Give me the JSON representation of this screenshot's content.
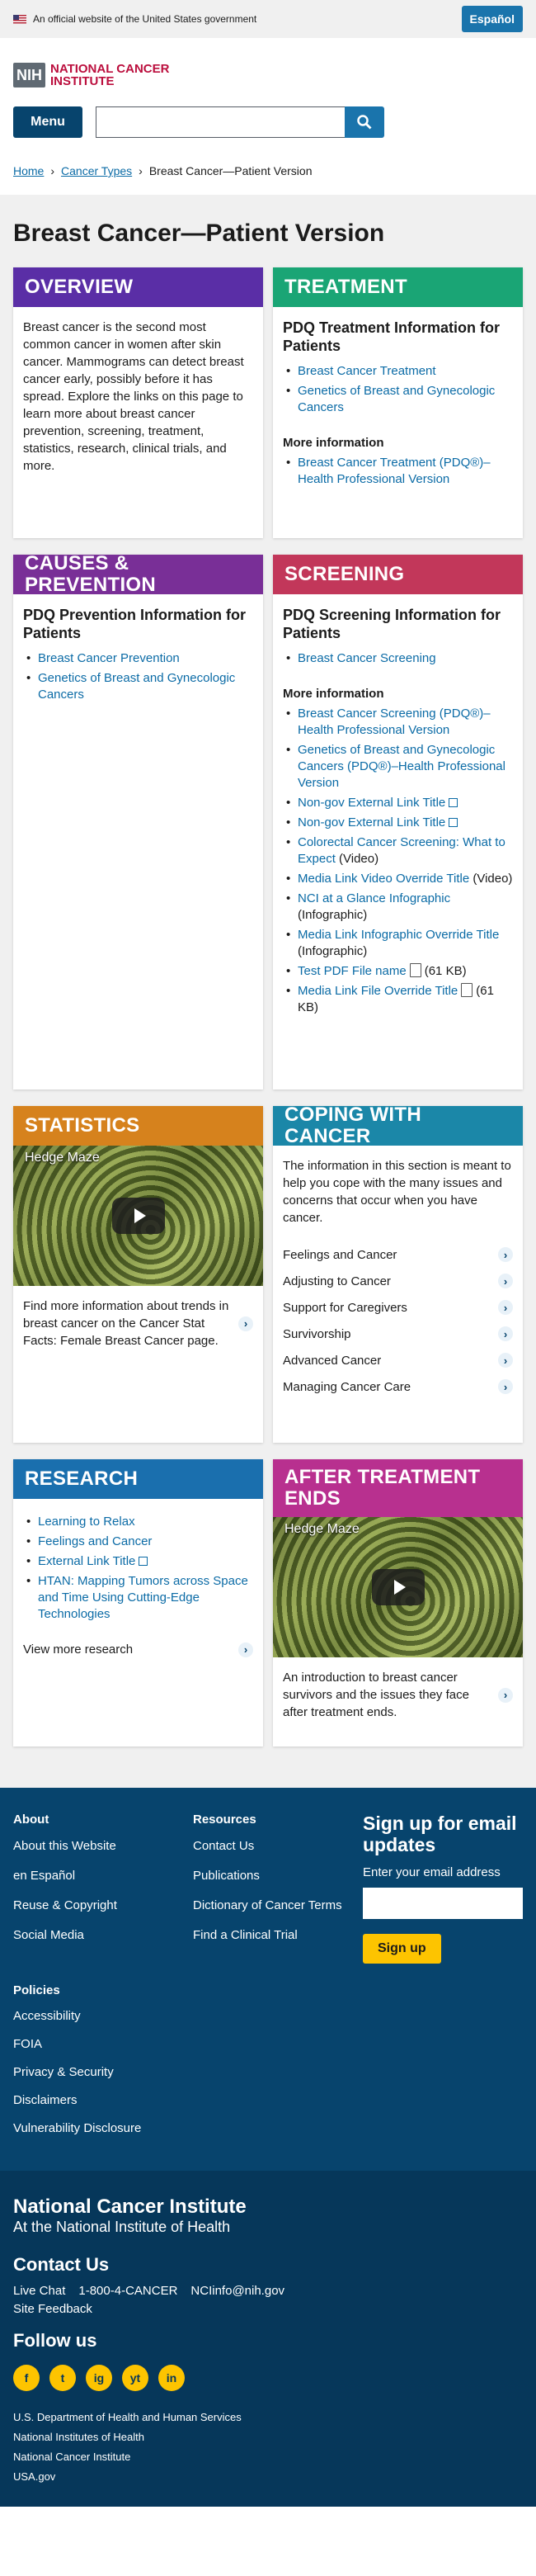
{
  "gov_banner": {
    "text": "An official website of the United States government",
    "espanol": "Español"
  },
  "header": {
    "logo_nih": "NIH",
    "logo_name_1": "NATIONAL CANCER",
    "logo_name_2": "INSTITUTE",
    "menu": "Menu",
    "search_placeholder": ""
  },
  "breadcrumb": {
    "home": "Home",
    "types": "Cancer Types",
    "current": "Breast Cancer—Patient Version"
  },
  "page_title": "Breast Cancer—Patient Version",
  "colors": {
    "overview": "#5a2ea6",
    "treatment": "#1aa575",
    "causes": "#792f97",
    "screening": "#c2375a",
    "statistics": "#d6821d",
    "coping": "#1b87a8",
    "research": "#1a6fae",
    "after": "#b8308f"
  },
  "overview": {
    "title": "OVERVIEW",
    "text": "Breast cancer is the second most common cancer in women after skin cancer. Mammograms can detect breast cancer early, possibly before it has spread. Explore the links on this page to learn more about breast cancer prevention, screening, treatment, statistics, research, clinical trials, and more."
  },
  "treatment": {
    "title": "TREATMENT",
    "subtitle": "PDQ Treatment Information for Patients",
    "links": [
      "Breast Cancer Treatment",
      "Genetics of Breast and Gynecologic Cancers"
    ],
    "more": "More information",
    "more_links": [
      "Breast Cancer Treatment (PDQ®)–Health Professional Version"
    ]
  },
  "causes": {
    "title": "CAUSES & PREVENTION",
    "subtitle": "PDQ Prevention Information for Patients",
    "links": [
      "Breast Cancer Prevention",
      "Genetics of Breast and Gynecologic Cancers"
    ]
  },
  "screening": {
    "title": "SCREENING",
    "subtitle": "PDQ Screening Information for Patients",
    "links": [
      "Breast Cancer Screening"
    ],
    "more": "More information",
    "more_links": [
      {
        "t": "Breast Cancer Screening (PDQ®)–Health Professional Version",
        "s": ""
      },
      {
        "t": "Genetics of Breast and Gynecologic Cancers (PDQ®)–Health Professional Version",
        "s": ""
      },
      {
        "t": "Non-gov External Link Title",
        "s": ""
      },
      {
        "t": "Non-gov External Link Title",
        "s": ""
      },
      {
        "t": "Colorectal Cancer Screening: What to Expect",
        "s": "(Video)"
      },
      {
        "t": "Media Link Video Override Title",
        "s": "(Video)"
      },
      {
        "t": "NCI at a Glance Infographic",
        "s": "(Infographic)"
      },
      {
        "t": "Media Link Infographic Override Title",
        "s": "(Infographic)"
      },
      {
        "t": "Test PDF File name",
        "s": "(61 KB)"
      },
      {
        "t": "Media Link File Override Title",
        "s": "(61 KB)"
      }
    ]
  },
  "statistics": {
    "title": "STATISTICS",
    "video_title": "Hedge Maze",
    "text": "Find more information about trends in breast cancer on the Cancer Stat Facts: Female Breast Cancer page."
  },
  "coping": {
    "title": "COPING WITH CANCER",
    "text": "The information in this section is meant to help you cope with the many issues and concerns that occur when you have cancer.",
    "items": [
      "Feelings and Cancer",
      "Adjusting to Cancer",
      "Support for Caregivers",
      "Survivorship",
      "Advanced Cancer",
      "Managing Cancer Care"
    ]
  },
  "research": {
    "title": "RESEARCH",
    "links": [
      "Learning to Relax",
      "Feelings and Cancer",
      "External Link Title",
      "HTAN: Mapping Tumors across Space and Time Using Cutting-Edge Technologies"
    ],
    "view_more": "View more research"
  },
  "after": {
    "title": "AFTER TREATMENT ENDS",
    "video_title": "Hedge Maze",
    "text": "An introduction to breast cancer survivors and the issues they face after treatment ends."
  },
  "footer": {
    "about": {
      "heading": "About",
      "links": [
        "About this Website",
        "en Español",
        "Reuse & Copyright",
        "Social Media"
      ]
    },
    "resources": {
      "heading": "Resources",
      "links": [
        "Contact Us",
        "Publications",
        "Dictionary of Cancer Terms",
        "Find a Clinical Trial"
      ]
    },
    "signup": {
      "heading": "Sign up for email updates",
      "label": "Enter your email address",
      "button": "Sign up"
    },
    "policies": {
      "heading": "Policies",
      "links": [
        "Accessibility",
        "FOIA",
        "Privacy & Security",
        "Disclaimers",
        "Vulnerability Disclosure"
      ]
    }
  },
  "identity": {
    "name": "National Cancer Institute",
    "sub": "At the National Institute of Health",
    "contact_heading": "Contact Us",
    "live_chat": "Live Chat",
    "phone": "1-800-4-CANCER",
    "email": "NCIinfo@nih.gov",
    "site_feedback": "Site Feedback",
    "follow": "Follow us",
    "social": [
      "f",
      "t",
      "ig",
      "yt",
      "in"
    ],
    "gov_links": [
      "U.S. Department of Health and Human Services",
      "National Institutes of Health",
      "National Cancer Institute",
      "USA.gov"
    ]
  }
}
